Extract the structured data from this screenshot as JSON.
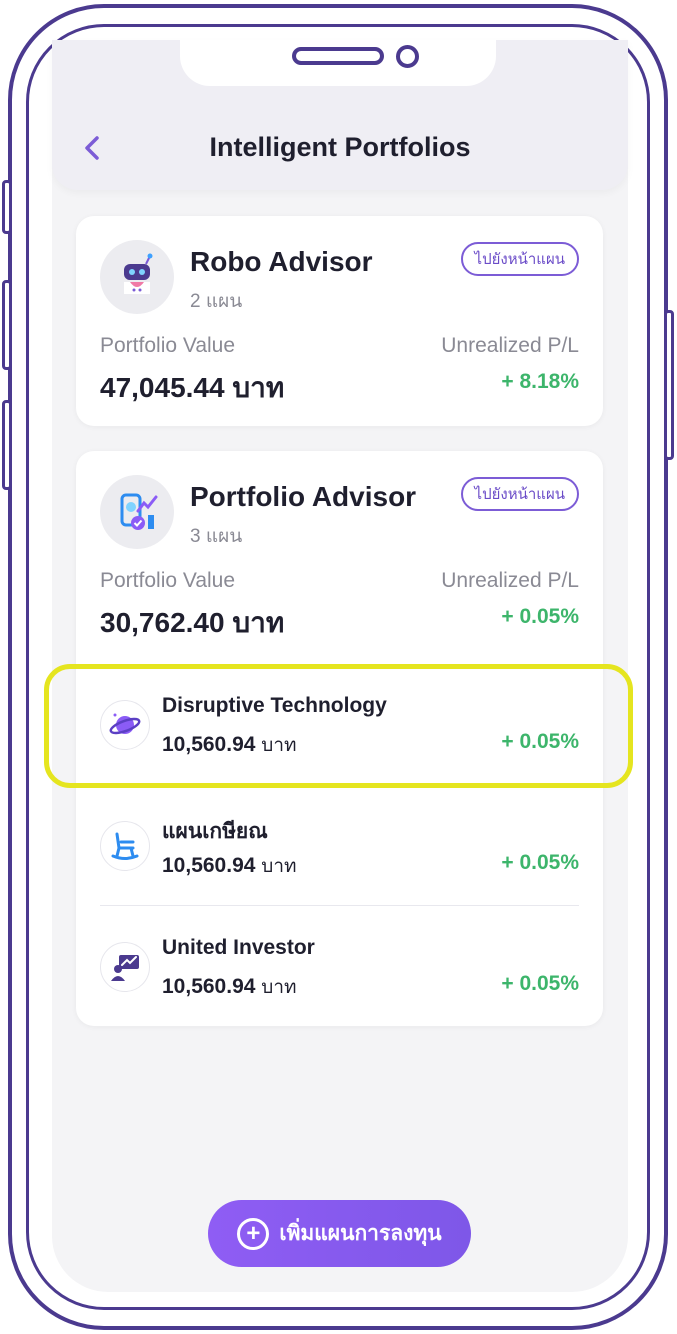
{
  "colors": {
    "frame": "#4b3a8f",
    "accent": "#7c5cd6",
    "positive": "#3db56b",
    "highlight": "#e5e51f",
    "background": "#f4f4f6"
  },
  "header": {
    "back_icon": "chevron-left-icon",
    "title": "Intelligent Portfolios"
  },
  "robo_card": {
    "icon": "robot-icon",
    "title": "Robo Advisor",
    "subtitle": "2 แผน",
    "plan_button": "ไปยังหน้าแผน",
    "value_label": "Portfolio Value",
    "value": "47,045.44 บาท",
    "pl_label": "Unrealized P/L",
    "pl": "+ 8.18%"
  },
  "portfolio_card": {
    "icon": "analytics-icon",
    "title": "Portfolio Advisor",
    "subtitle": "3 แผน",
    "plan_button": "ไปยังหน้าแผน",
    "value_label": "Portfolio Value",
    "value": "30,762.40 บาท",
    "pl_label": "Unrealized P/L",
    "pl": "+ 0.05%",
    "plans": [
      {
        "icon": "planet-icon",
        "name": "Disruptive Technology",
        "amount": "10,560.94",
        "unit": "บาท",
        "pl": "+ 0.05%"
      },
      {
        "icon": "rocking-chair-icon",
        "name": "แผนเกษียณ",
        "amount": "10,560.94",
        "unit": "บาท",
        "pl": "+ 0.05%"
      },
      {
        "icon": "investor-icon",
        "name": "United Investor",
        "amount": "10,560.94",
        "unit": "บาท",
        "pl": "+ 0.05%"
      }
    ]
  },
  "add_button": {
    "icon": "plus-circle-icon",
    "label": "เพิ่มแผนการลงทุน"
  }
}
